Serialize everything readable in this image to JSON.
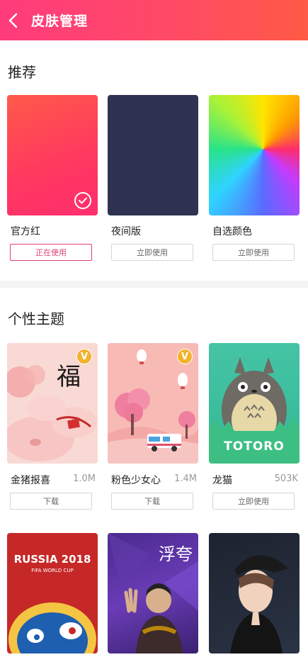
{
  "header": {
    "title": "皮肤管理"
  },
  "recommend": {
    "title": "推荐",
    "items": [
      {
        "label": "官方红",
        "button": "正在使用",
        "active": true
      },
      {
        "label": "夜间版",
        "button": "立即使用",
        "active": false
      },
      {
        "label": "自选颜色",
        "button": "立即使用",
        "active": false
      }
    ]
  },
  "themes": {
    "title": "个性主题",
    "items": [
      {
        "label": "金猪报喜",
        "size": "1.0M",
        "button": "下载",
        "vip": "V",
        "art_text": "福"
      },
      {
        "label": "粉色少女心",
        "size": "1.4M",
        "button": "下载",
        "vip": "V"
      },
      {
        "label": "龙猫",
        "size": "503K",
        "button": "立即使用",
        "art_text": "TOTORO"
      }
    ],
    "row2": [
      {
        "art_title": "RUSSIA 2018",
        "art_subtitle": "FIFA WORLD CUP"
      },
      {
        "art_text": "浮夸"
      },
      {}
    ]
  },
  "colors": {
    "accent": "#e0407a",
    "header_start": "#ff3b7c",
    "header_end": "#ff5a45"
  }
}
